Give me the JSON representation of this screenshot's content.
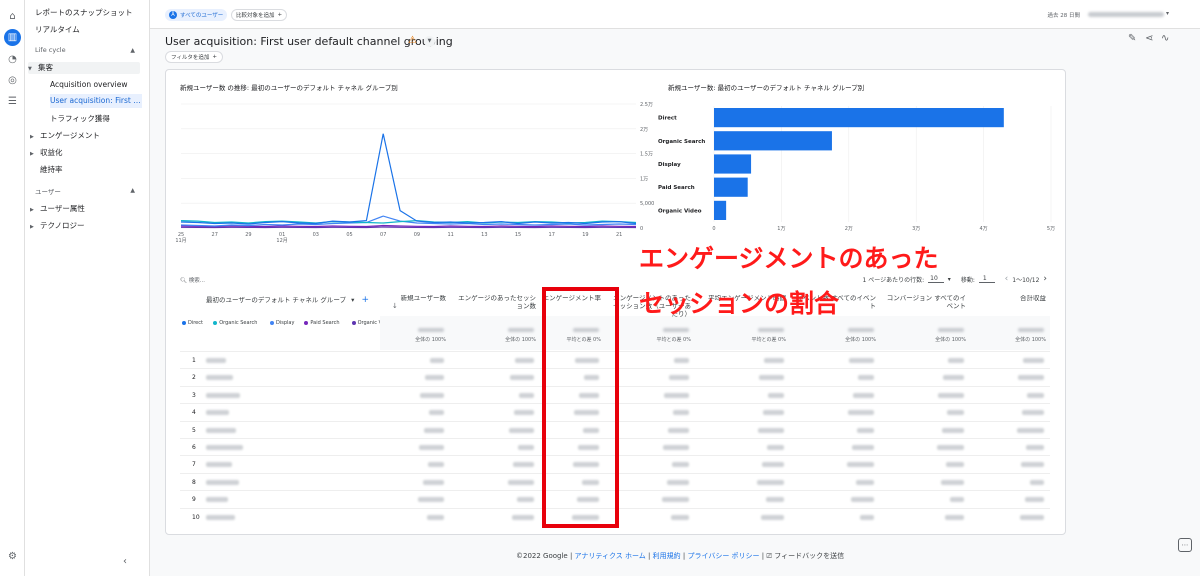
{
  "nav": {
    "snapshot": "レポートのスナップショット",
    "realtime": "リアルタイム",
    "lifecycle": "Life cycle",
    "acquisition": "集客",
    "acq_overview": "Acquisition overview",
    "user_acq": "User acquisition: First user ...",
    "traffic_acq": "トラフィック獲得",
    "engagement": "エンゲージメント",
    "monetization": "収益化",
    "retention": "維持率",
    "user_section": "ユーザー",
    "user_attr": "ユーザー属性",
    "technology": "テクノロジー"
  },
  "topbar": {
    "all_users": "すべてのユーザー",
    "add_compare": "比較対象を追加",
    "date_range_label": "過去 28 日間"
  },
  "page": {
    "title": "User acquisition: First user default channel grouping",
    "add_filter": "フィルタを追加"
  },
  "line_chart": {
    "title": "新規ユーザー数 の推移: 最初のユーザーのデフォルト チャネル グループ別",
    "y_ticks": [
      "2.5万",
      "2万",
      "1.5万",
      "1万",
      "5,000",
      "0"
    ],
    "x_ticks": [
      "25",
      "27",
      "29",
      "01",
      "03",
      "05",
      "07",
      "09",
      "11",
      "13",
      "15",
      "17",
      "19",
      "21"
    ],
    "x_month_labels": [
      "11月",
      "12月"
    ],
    "legend": [
      "Direct",
      "Organic Search",
      "Display",
      "Paid Search",
      "Organic Video"
    ]
  },
  "bar_chart": {
    "title": "新規ユーザー数: 最初のユーザーのデフォルト チャネル グループ別",
    "x_ticks": [
      "0",
      "1万",
      "2万",
      "3万",
      "4万",
      "5万"
    ]
  },
  "chart_data": [
    {
      "type": "line",
      "x": [
        "25",
        "26",
        "27",
        "28",
        "29",
        "30",
        "01",
        "02",
        "03",
        "04",
        "05",
        "06",
        "07",
        "08",
        "09",
        "10",
        "11",
        "12",
        "13",
        "14",
        "15",
        "16",
        "17",
        "18",
        "19",
        "20",
        "21",
        "22"
      ],
      "ylim": [
        0,
        25000
      ],
      "series": [
        {
          "name": "Direct",
          "color": "#1a73e8",
          "values": [
            1200,
            1100,
            900,
            1000,
            800,
            1100,
            1300,
            1000,
            900,
            1400,
            1200,
            1500,
            19000,
            3500,
            1400,
            1100,
            1200,
            1000,
            1100,
            1300,
            900,
            1200,
            1000,
            1100,
            900,
            1200,
            1300,
            900
          ]
        },
        {
          "name": "Organic Search",
          "color": "#12b5cb",
          "values": [
            1500,
            1400,
            1100,
            1200,
            1000,
            1300,
            1400,
            1200,
            1000,
            1300,
            1200,
            1100,
            1000,
            1300,
            1500,
            1200,
            1100,
            1300,
            1000,
            1200,
            1100,
            1300,
            1200,
            1000,
            1100,
            1400,
            1300,
            1100
          ]
        },
        {
          "name": "Display",
          "color": "#4285f4",
          "values": [
            600,
            500,
            400,
            600,
            500,
            700,
            600,
            800,
            700,
            900,
            1000,
            1100,
            2400,
            1400,
            1000,
            900,
            800,
            900,
            700,
            800,
            700,
            600,
            700,
            800,
            600,
            700,
            800,
            700
          ]
        },
        {
          "name": "Paid Search",
          "color": "#7627bb",
          "values": [
            400,
            350,
            300,
            400,
            350,
            300,
            400,
            350,
            300,
            400,
            350,
            300,
            500,
            400,
            350,
            300,
            400,
            350,
            300,
            400,
            350,
            300,
            400,
            350,
            300,
            400,
            350,
            300
          ]
        },
        {
          "name": "Organic Video",
          "color": "#5e35b1",
          "values": [
            150,
            120,
            100,
            150,
            120,
            100,
            150,
            120,
            100,
            150,
            120,
            100,
            200,
            150,
            120,
            100,
            150,
            120,
            100,
            150,
            120,
            100,
            150,
            120,
            100,
            150,
            120,
            100
          ]
        }
      ]
    },
    {
      "type": "bar",
      "categories": [
        "Direct",
        "Organic Search",
        "Display",
        "Paid Search",
        "Organic Video"
      ],
      "values": [
        43000,
        17500,
        5500,
        5000,
        1800
      ],
      "xlim": [
        0,
        50000
      ],
      "color": "#1a73e8"
    }
  ],
  "table": {
    "search_placeholder": "検索...",
    "rows_per_page_label": "1 ページあたりの行数:",
    "rows_per_page": "10",
    "goto_label": "移動:",
    "goto_value": "1",
    "range": "1〜10/12",
    "dim_header": "最初のユーザーのデフォルト チャネル グループ",
    "headers": [
      "新規ユーザー数",
      "エンゲージのあったセッション数",
      "エンゲージメント率",
      "エンゲージメントのあったセッション数（ユーザーあたり）",
      "平均エンゲージメント時間",
      "イベント数 すべてのイベント",
      "コンバージョン すべてのイベント",
      "合計収益"
    ],
    "totals_sub": [
      "全体の 100%",
      "全体の 100%",
      "平均との差 0%",
      "平均との差 0%",
      "平均との差 0%",
      "全体の 100%",
      "全体の 100%",
      "全体の 100%"
    ],
    "row_numbers": [
      "1",
      "2",
      "3",
      "4",
      "5",
      "6",
      "7",
      "8",
      "9",
      "10"
    ]
  },
  "annotation": {
    "line1": "エンゲージメントのあった",
    "line2": "セッションの割合",
    "color": "#ff1a1a"
  },
  "footer": {
    "copyright": "©2022 Google |",
    "link1": "アナリティクス ホーム",
    "sep": "|",
    "link2": "利用規約",
    "link3": "プライバシー ポリシー",
    "feedback": "フィードバックを送信"
  }
}
